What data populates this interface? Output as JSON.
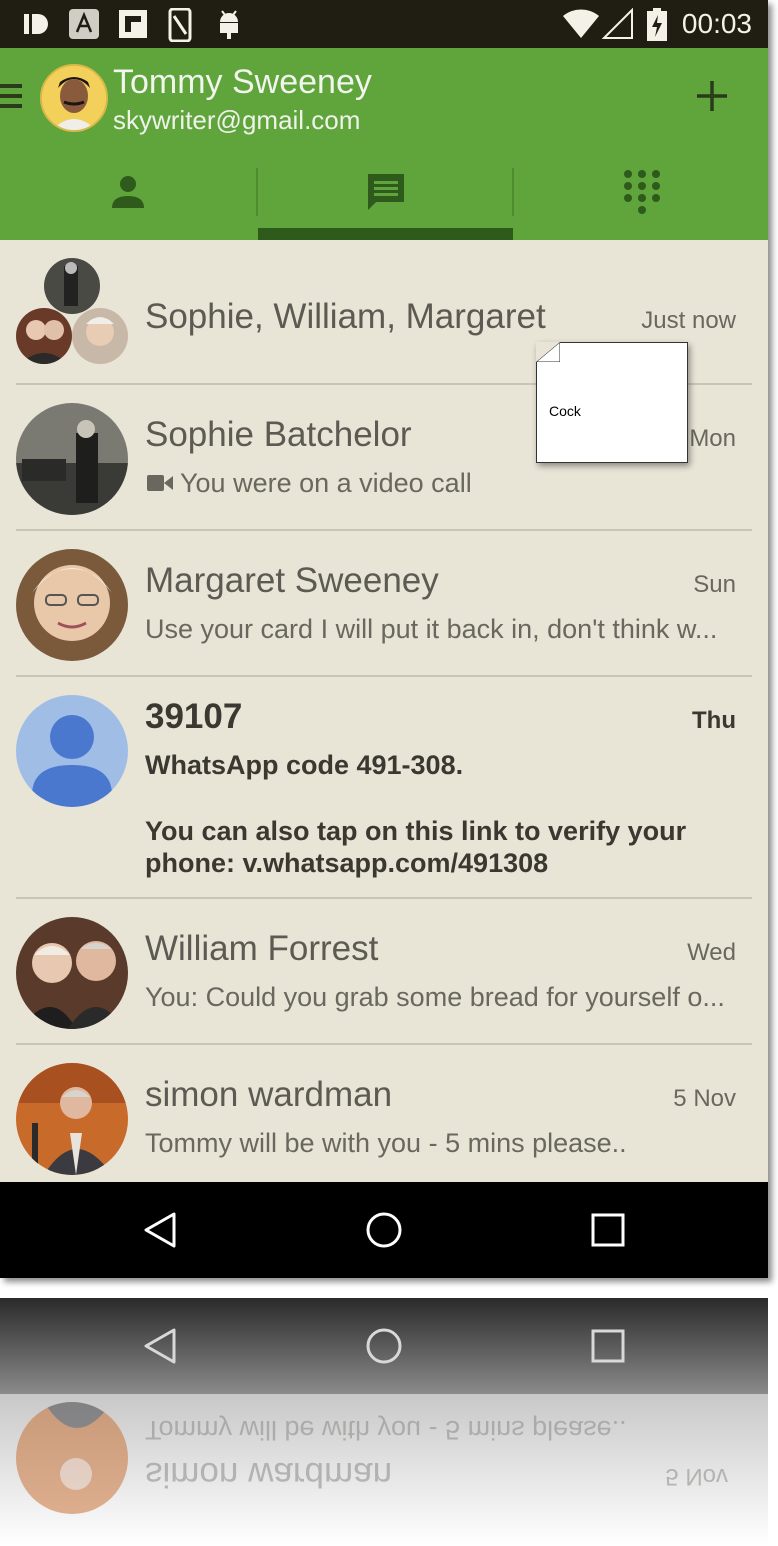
{
  "status_bar": {
    "time": "00:03"
  },
  "account": {
    "name": "Tommy Sweeney",
    "email": "skywriter@gmail.com"
  },
  "tabs": [
    {
      "icon": "person-icon"
    },
    {
      "icon": "chat-icon",
      "selected": true
    },
    {
      "icon": "dialpad-icon"
    }
  ],
  "conversations": [
    {
      "name": "Sophie, William, Margaret",
      "time": "Just now",
      "snippet": ""
    },
    {
      "name": "Sophie Batchelor",
      "time": "Mon",
      "snippet": "You were on a video call",
      "snippet_icon": "videocam-icon"
    },
    {
      "name": "Margaret Sweeney",
      "time": "Sun",
      "snippet": "Use your card I will put it back in, don't think w..."
    },
    {
      "name": "39107",
      "time": "Thu",
      "snippet": "WhatsApp code 491-308.",
      "snippet2": "You can also tap on this link to verify your",
      "snippet3": "phone: v.whatsapp.com/491308",
      "unread": true
    },
    {
      "name": "William Forrest",
      "time": "Wed",
      "snippet": "You: Could you grab some bread for yourself o..."
    },
    {
      "name": "simon wardman",
      "time": "5 Nov",
      "snippet": "Tommy will be with you - 5 mins please.."
    }
  ],
  "sticky_note": {
    "text": "Cock"
  },
  "colors": {
    "appbar": "#5fa53c",
    "list_bg": "#e8e4d6",
    "status_bar": "#201e12"
  }
}
